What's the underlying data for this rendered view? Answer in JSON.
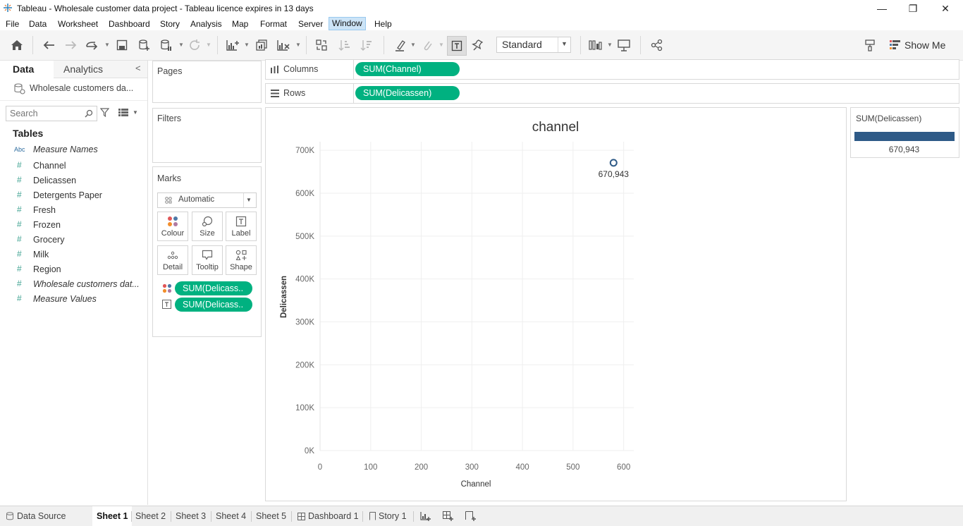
{
  "window": {
    "title": "Tableau - Wholesale customer data project - Tableau licence expires in 13 days",
    "minimize_glyph": "—",
    "restore_glyph": "❐",
    "close_glyph": "✕"
  },
  "menu": [
    "File",
    "Data",
    "Worksheet",
    "Dashboard",
    "Story",
    "Analysis",
    "Map",
    "Format",
    "Server",
    "Window",
    "Help"
  ],
  "toolbar": {
    "fit_value": "Standard",
    "show_me_label": "Show Me"
  },
  "datapane": {
    "tab_data": "Data",
    "tab_analytics": "Analytics",
    "datasource": "Wholesale customers da...",
    "search_placeholder": "Search",
    "tables_heading": "Tables",
    "abc_tag": "Abc",
    "fields": [
      {
        "name": "Measure Names",
        "type": "abc",
        "italic": true
      },
      {
        "name": "Channel",
        "type": "measure",
        "italic": false
      },
      {
        "name": "Delicassen",
        "type": "measure",
        "italic": false
      },
      {
        "name": "Detergents Paper",
        "type": "measure",
        "italic": false
      },
      {
        "name": "Fresh",
        "type": "measure",
        "italic": false
      },
      {
        "name": "Frozen",
        "type": "measure",
        "italic": false
      },
      {
        "name": "Grocery",
        "type": "measure",
        "italic": false
      },
      {
        "name": "Milk",
        "type": "measure",
        "italic": false
      },
      {
        "name": "Region",
        "type": "measure",
        "italic": false
      },
      {
        "name": "Wholesale customers dat...",
        "type": "measure",
        "italic": true
      },
      {
        "name": "Measure Values",
        "type": "measure",
        "italic": true
      }
    ]
  },
  "cards": {
    "pages": "Pages",
    "filters": "Filters",
    "marks": "Marks",
    "mark_type": "Automatic",
    "buttons": [
      "Colour",
      "Size",
      "Label",
      "Detail",
      "Tooltip",
      "Shape"
    ],
    "mark_pills": [
      "SUM(Delicass..",
      "SUM(Delicass.."
    ]
  },
  "shelves": {
    "columns_label": "Columns",
    "columns_pill": "SUM(Channel)",
    "rows_label": "Rows",
    "rows_pill": "SUM(Delicassen)"
  },
  "chart_data": {
    "type": "scatter",
    "title": "channel",
    "xlabel": "Channel",
    "ylabel": "Delicassen",
    "xlim": [
      0,
      620
    ],
    "ylim": [
      0,
      720000
    ],
    "x_ticks": [
      0,
      100,
      200,
      300,
      400,
      500,
      600
    ],
    "y_ticks": [
      0,
      100000,
      200000,
      300000,
      400000,
      500000,
      600000,
      700000
    ],
    "x_tick_labels": [
      "0",
      "100",
      "200",
      "300",
      "400",
      "500",
      "600"
    ],
    "y_tick_labels": [
      "0K",
      "100K",
      "200K",
      "300K",
      "400K",
      "500K",
      "600K",
      "700K"
    ],
    "points": [
      {
        "x": 580,
        "y": 670943,
        "label": "670,943"
      }
    ],
    "grid": true,
    "mark_color": "#2e5a87"
  },
  "legend": {
    "title": "SUM(Delicassen)",
    "value": "670,943",
    "color": "#2e5a87"
  },
  "tabs": {
    "data_source": "Data Source",
    "sheets": [
      "Sheet 1",
      "Sheet 2",
      "Sheet 3",
      "Sheet 4",
      "Sheet 5"
    ],
    "dashboard": "Dashboard 1",
    "story": "Story 1",
    "active": "Sheet 1"
  },
  "colors": {
    "pill": "#00b180",
    "accent_blue": "#2e5a87"
  }
}
